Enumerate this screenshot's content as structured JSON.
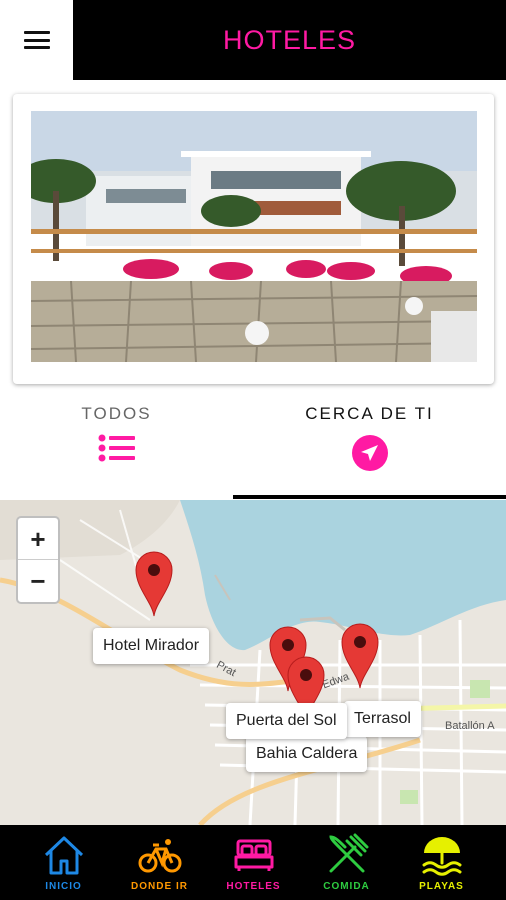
{
  "header": {
    "title": "HOTELES"
  },
  "tabs": [
    {
      "label": "TODOS",
      "icon": "list-icon"
    },
    {
      "label": "CERCA DE TI",
      "icon": "navigation-arrow-icon"
    }
  ],
  "map": {
    "zoom_in": "+",
    "zoom_out": "−",
    "hotels": [
      {
        "name": "Hotel Mirador"
      },
      {
        "name": "Puerta del Sol"
      },
      {
        "name": "Terrasol"
      },
      {
        "name": "Bahia Caldera"
      }
    ],
    "street_labels": [
      "Prat",
      "Edwa",
      "Batallón A"
    ]
  },
  "bottom_nav": [
    {
      "label": "INICIO",
      "icon": "home-icon",
      "color": "#1e88e5"
    },
    {
      "label": "DONDE IR",
      "icon": "bicycle-icon",
      "color": "#ff9800"
    },
    {
      "label": "HOTELES",
      "icon": "bed-icon",
      "color": "#ff1aa3"
    },
    {
      "label": "COMIDA",
      "icon": "fork-knife-icon",
      "color": "#2ecc40"
    },
    {
      "label": "PLAYAS",
      "icon": "beach-umbrella-icon",
      "color": "#e6f000"
    }
  ],
  "colors": {
    "accent": "#ff1aa3",
    "marker": "#e53935",
    "sea": "#aad3df",
    "land": "#eae6df"
  }
}
